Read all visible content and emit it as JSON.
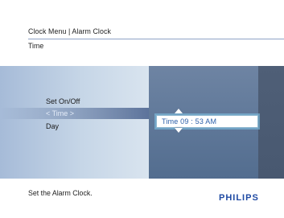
{
  "header": {
    "breadcrumb": "Clock Menu | Alarm Clock",
    "title": "Time"
  },
  "menu": {
    "items": [
      {
        "label": "Set On/Off"
      },
      {
        "label": "< Time >"
      },
      {
        "label": "Day"
      }
    ],
    "selected_index": 1
  },
  "time_editor": {
    "value": "Time 09 : 53  AM",
    "up_icon": "triangle-up-icon",
    "down_icon": "triangle-down-icon"
  },
  "footer": {
    "help_text": "Set the Alarm Clock.",
    "brand": "PHILIPS"
  },
  "colors": {
    "brand_blue": "#1f4aa3",
    "time_text_blue": "#2b5ea8",
    "panel_left": "#c6d6e7",
    "panel_mid": "#5d7697",
    "panel_right": "#485870"
  }
}
